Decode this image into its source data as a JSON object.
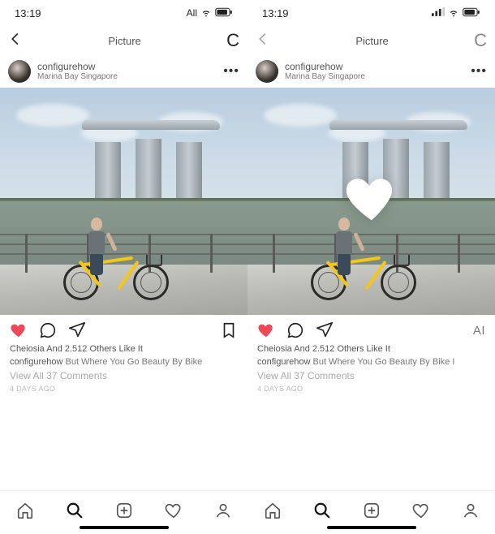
{
  "left": {
    "statusbar": {
      "time": "13:19",
      "network": "All",
      "wifi": "wifi-icon",
      "battery": "battery-icon"
    },
    "navbar": {
      "title": "Picture",
      "refresh_label": "C"
    },
    "post": {
      "username": "configurehow",
      "location": "Marina Bay Singapore",
      "likes_line": "Cheiosia And 2.512 Others Like It",
      "caption_user": "configurehow",
      "caption_text": " But Where You Go Beauty By Bike",
      "view_comments": "View All 37 Comments",
      "time_ago": "4 DAYS AGO"
    },
    "bookmark_visible": true,
    "heart_overlay": false
  },
  "right": {
    "statusbar": {
      "time": "13:19",
      "network": "",
      "wifi": "wifi-icon",
      "battery": "battery-icon"
    },
    "navbar": {
      "title": "Picture",
      "refresh_label": "C"
    },
    "post": {
      "username": "configurehow",
      "location": "Marina Bay Singapore",
      "likes_line": "Cheiosia And 2.512 Others Like It",
      "caption_user": "configurehow",
      "caption_text": " But Where You Go Beauty By Bike I",
      "view_comments": "View All 37 Comments",
      "time_ago": "4 DAYS AGO"
    },
    "bookmark_label": "AI",
    "heart_overlay": true
  }
}
